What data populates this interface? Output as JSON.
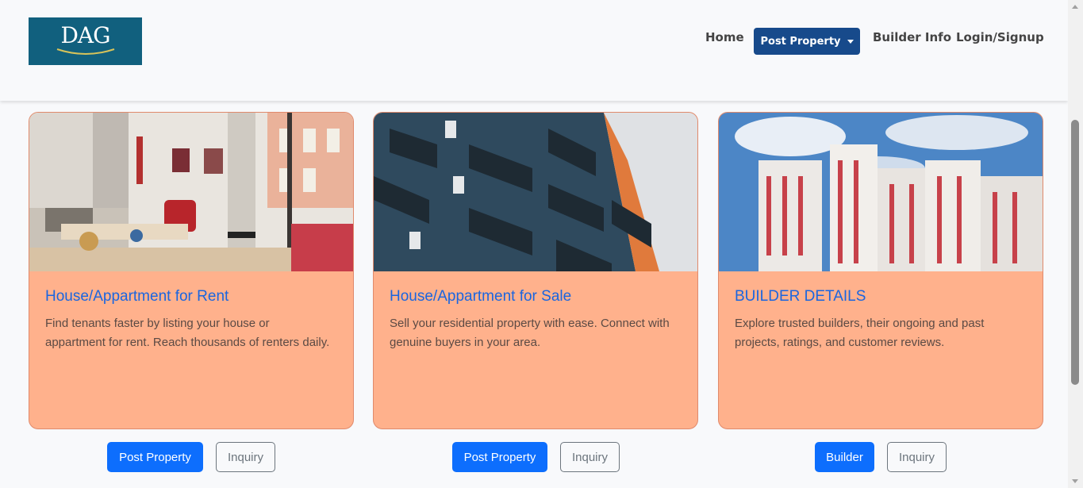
{
  "brand": {
    "logo_text": "DAG",
    "logo_bg": "#11607e"
  },
  "nav": {
    "home": "Home",
    "post_property": "Post Property",
    "builder_info": "Builder Info",
    "login": "Login/Signup"
  },
  "cards": [
    {
      "title": "House/Appartment for Rent",
      "text": "Find tenants faster by listing your house or appartment for rent. Reach thousands of renters daily.",
      "image": "living-room-photo",
      "primary_button": "Post Property",
      "secondary_button": "Inquiry"
    },
    {
      "title": "House/Appartment for Sale",
      "text": "Sell your residential property with ease. Connect with genuine buyers in your area.",
      "image": "apartment-balconies-photo",
      "primary_button": "Post Property",
      "secondary_button": "Inquiry"
    },
    {
      "title": "BUILDER DETAILS",
      "text": "Explore trusted builders, their ongoing and past projects, ratings, and customer reviews.",
      "image": "high-rise-buildings-photo",
      "primary_button": "Builder",
      "secondary_button": "Inquiry"
    }
  ],
  "colors": {
    "accent": "#0d6efd",
    "nav_button": "#174a8b",
    "card_bg": "#ffb18c",
    "card_title": "#1a65e0"
  }
}
